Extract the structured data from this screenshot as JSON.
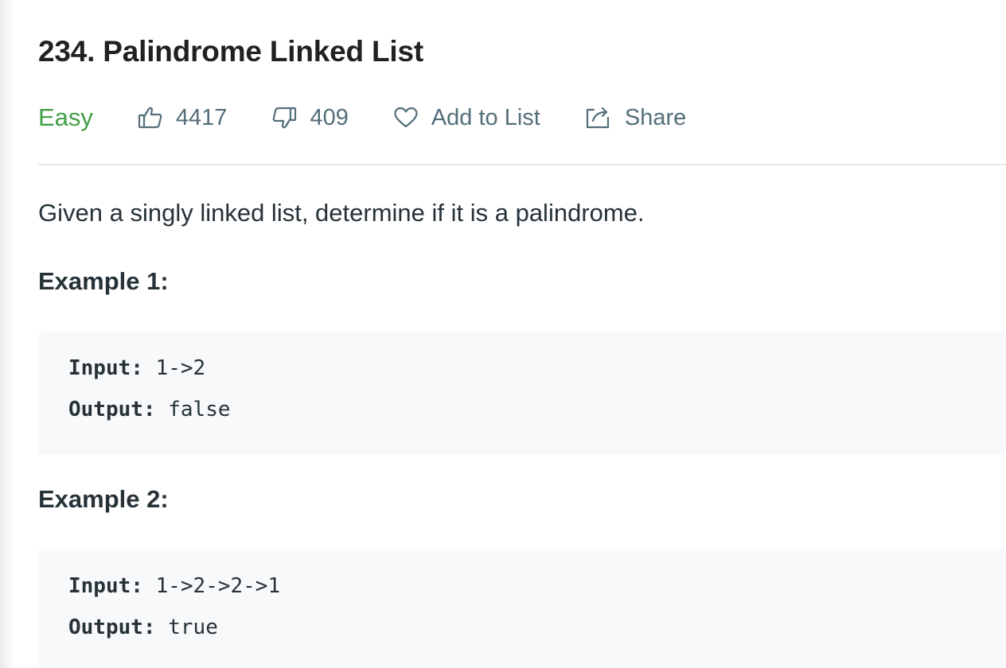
{
  "problem": {
    "title": "234. Palindrome Linked List",
    "difficulty": "Easy",
    "likes": "4417",
    "dislikes": "409",
    "add_to_list_label": "Add to List",
    "share_label": "Share",
    "description": "Given a singly linked list, determine if it is a palindrome."
  },
  "icons": {
    "like": "thumbs-up-icon",
    "dislike": "thumbs-down-icon",
    "add_to_list": "heart-icon",
    "share": "share-icon"
  },
  "colors": {
    "difficulty_easy": "#43a047",
    "meta_text": "#546e7a",
    "code_background": "#f7f9fa"
  },
  "examples": [
    {
      "heading": "Example 1:",
      "input_key": "Input:",
      "input_value": "1->2",
      "output_key": "Output:",
      "output_value": "false"
    },
    {
      "heading": "Example 2:",
      "input_key": "Input:",
      "input_value": "1->2->2->1",
      "output_key": "Output:",
      "output_value": "true"
    }
  ]
}
